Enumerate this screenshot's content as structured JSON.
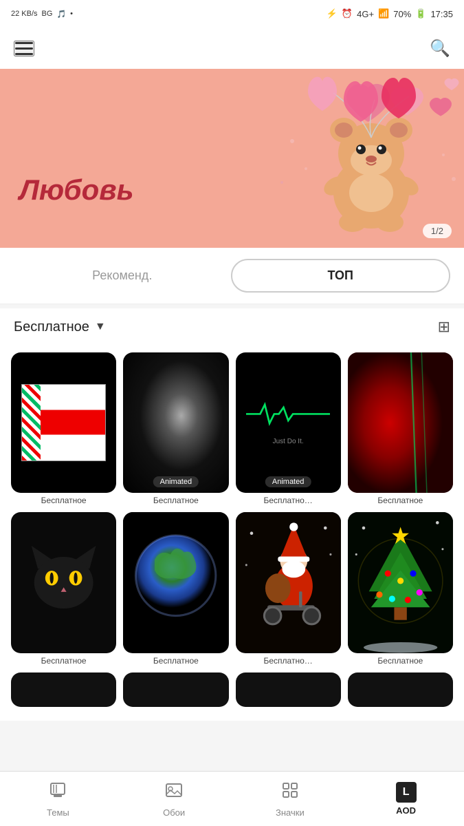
{
  "statusBar": {
    "leftInfo": "22 KB/s",
    "carrier": "BG",
    "time": "17:35",
    "battery": "70%",
    "signal": "4G+"
  },
  "header": {
    "title": ""
  },
  "banner": {
    "title": "Любовь",
    "indicator": "1/2"
  },
  "tabs": [
    {
      "id": "recommended",
      "label": "Рекоменд.",
      "active": false
    },
    {
      "id": "top",
      "label": "ТОП",
      "active": true
    }
  ],
  "filter": {
    "label": "Бесплатное",
    "arrowLabel": "▼"
  },
  "wallpapers": [
    {
      "id": "w1",
      "label": "Бесплатное",
      "type": "flag",
      "animated": false
    },
    {
      "id": "w2",
      "label": "Бесплатное",
      "type": "galaxy",
      "animated": true
    },
    {
      "id": "w3",
      "label": "Бесплатно…",
      "type": "heartbeat",
      "animated": true
    },
    {
      "id": "w4",
      "label": "Бесплатное",
      "type": "red-fabric",
      "animated": false
    },
    {
      "id": "w5",
      "label": "Бесплатное",
      "type": "black-cat",
      "animated": false
    },
    {
      "id": "w6",
      "label": "Бесплатное",
      "type": "earth",
      "animated": false
    },
    {
      "id": "w7",
      "label": "Бесплатно…",
      "type": "santa",
      "animated": false
    },
    {
      "id": "w8",
      "label": "Бесплатное",
      "type": "xmas",
      "animated": false
    },
    {
      "id": "w9",
      "label": "",
      "type": "placeholder",
      "animated": false
    },
    {
      "id": "w10",
      "label": "",
      "type": "placeholder",
      "animated": false
    },
    {
      "id": "w11",
      "label": "",
      "type": "placeholder",
      "animated": false
    },
    {
      "id": "w12",
      "label": "",
      "type": "placeholder",
      "animated": false
    }
  ],
  "animatedBadge": "Animated",
  "bottomNav": [
    {
      "id": "themes",
      "label": "Темы",
      "icon": "themes",
      "active": false
    },
    {
      "id": "wallpapers",
      "label": "Обои",
      "icon": "wallpapers",
      "active": false
    },
    {
      "id": "icons",
      "label": "Значки",
      "icon": "icons",
      "active": false
    },
    {
      "id": "aod",
      "label": "AOD",
      "icon": "aod",
      "active": true
    }
  ]
}
